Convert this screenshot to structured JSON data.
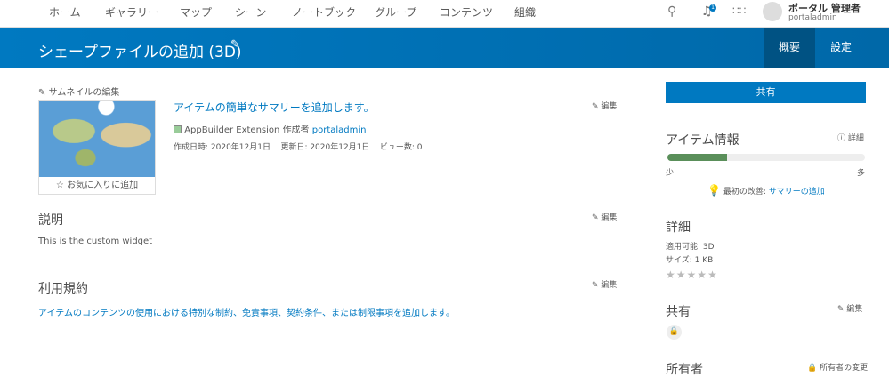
{
  "nav": {
    "items": [
      "ホーム",
      "ギャラリー",
      "マップ",
      "シーン",
      "ノートブック",
      "グループ",
      "コンテンツ",
      "組織"
    ],
    "notification_count": "1",
    "user_name": "ポータル 管理者",
    "user_id": "portaladmin"
  },
  "header": {
    "title": "シェープファイルの追加 (3D)",
    "tabs": [
      "概要",
      "設定"
    ]
  },
  "thumb": {
    "edit_label": "サムネイルの編集",
    "favorite_label": "お気に入りに追加"
  },
  "summary": {
    "text": "アイテムの簡単なサマリーを追加します。",
    "edit": "編集",
    "type": "AppBuilder Extension",
    "by": "作成者",
    "owner": "portaladmin",
    "created": "作成日時: 2020年12月1日",
    "updated": "更新日: 2020年12月1日",
    "views": "ビュー数: 0"
  },
  "description": {
    "title": "説明",
    "edit": "編集",
    "text": "This is the custom widget"
  },
  "terms": {
    "title": "利用規約",
    "edit": "編集",
    "text": "アイテムのコンテンツの使用における特別な制約、免責事項、契約条件、または制限事項を追加します。"
  },
  "side": {
    "share_button": "共有",
    "info_title": "アイテム情報",
    "info_detail": "詳細",
    "progress_percent": 30,
    "low": "少",
    "high": "多",
    "tip_label": "最初の改善:",
    "tip_link": "サマリーの追加",
    "details_title": "詳細",
    "applicable": "適用可能: 3D",
    "size": "サイズ: 1 KB",
    "rating": 0,
    "sharing_title": "共有",
    "sharing_edit": "編集",
    "owner_title": "所有者",
    "owner_change": "所有者の変更"
  }
}
